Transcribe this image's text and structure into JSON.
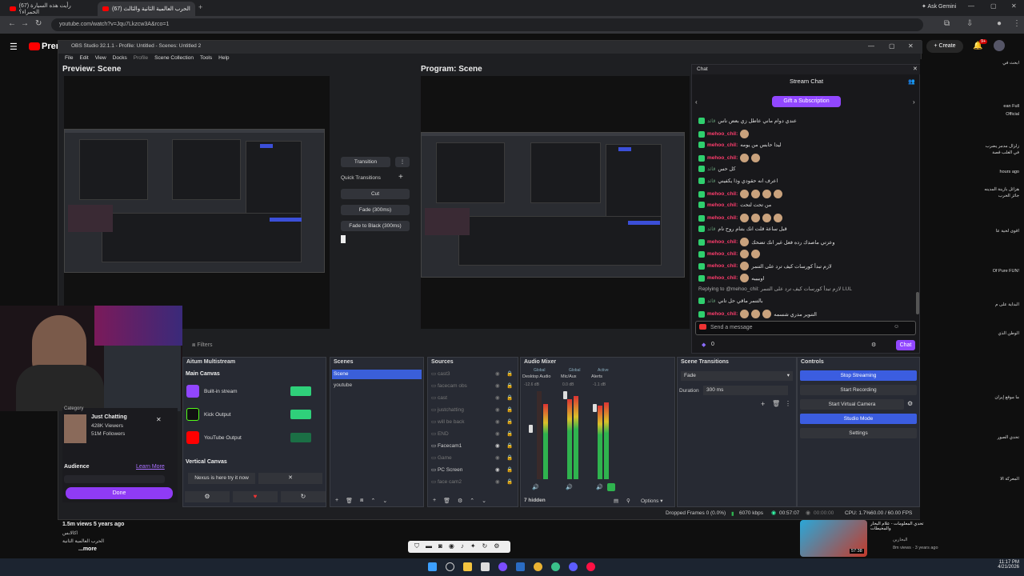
{
  "browser": {
    "tabs": [
      {
        "label": "(67) رأيت هذه السيارة الحمراء؟"
      },
      {
        "label": "(67) الحرب العالمية الثانية والثالث"
      }
    ],
    "url": "youtube.com/watch?v=Jqu7Lkzcw3A&rco=1",
    "ask_gemini": "Ask Gemini"
  },
  "youtube": {
    "logo": "Premium",
    "create": "Create",
    "notif_count": "9+",
    "video_stats": "1.5m views  5 years ago",
    "desc_lines": [
      "اكالابس",
      "الحرب العالمية الثانية",
      "...more"
    ],
    "side_items": [
      {
        "text": "ابحث في"
      },
      {
        "text": "ean Full"
      },
      {
        "text": "Official"
      },
      {
        "text": "زلزال مدمر يضرب"
      },
      {
        "text": "في الغلب قصة"
      },
      {
        "text": "hours ago"
      },
      {
        "text": "هزائل بازينة المدينه"
      },
      {
        "text": "جائز الحرب"
      },
      {
        "text": "اقوى لحية عا"
      },
      {
        "text": "Of Pure FUN!"
      },
      {
        "text": "البداية على م"
      },
      {
        "text": "الوطن الذي"
      },
      {
        "text": "ما موقع إيران"
      },
      {
        "text": "تحدي الصور"
      },
      {
        "text": "المعركة الا"
      }
    ],
    "rec_title": "تحدي المعلومات - علام البحار والمحيطات",
    "rec_channel": "البحارين",
    "rec_meta": "8m views · 3 years ago",
    "rec_duration": "57:38"
  },
  "obs": {
    "title": "OBS Studio 32.1.1 - Profile: Untitled - Scenes: Untitled 2",
    "menu": [
      "File",
      "Edit",
      "View",
      "Docks",
      "Profile",
      "Scene Collection",
      "Tools",
      "Help"
    ],
    "preview_label": "Preview: Scene",
    "program_label": "Program: Scene",
    "transition_btn": "Transition",
    "quick_transitions": "Quick Transitions",
    "qt_items": [
      "Cut",
      "Fade (300ms)",
      "Fade to Black (300ms)"
    ],
    "filters_label": "Filters",
    "docks": {
      "multistream": {
        "title": "Aitum Multistream",
        "main_canvas": "Main Canvas",
        "outputs": [
          {
            "label": "Built-in stream",
            "color": "#9146ff"
          },
          {
            "label": "Kick Output",
            "color": "#53fc18"
          },
          {
            "label": "YouTube Output",
            "color": "#ff0000"
          }
        ],
        "vertical_canvas": "Vertical Canvas",
        "vertical_item": "Nexus is here try it now"
      },
      "scenes": {
        "title": "Scenes",
        "items": [
          "Scene",
          "youtube"
        ]
      },
      "sources": {
        "title": "Sources",
        "items": [
          {
            "label": "cast3",
            "dim": true
          },
          {
            "label": "facecam obs",
            "dim": true
          },
          {
            "label": "cast",
            "dim": true
          },
          {
            "label": "justchatting",
            "dim": true
          },
          {
            "label": "will be back",
            "dim": true
          },
          {
            "label": "END",
            "dim": true
          },
          {
            "label": "Facecam1",
            "dim": false
          },
          {
            "label": "Game",
            "dim": true
          },
          {
            "label": "PC Screen",
            "dim": false
          },
          {
            "label": "face cam2",
            "dim": true
          }
        ]
      },
      "mixer": {
        "title": "Audio Mixer",
        "channels": [
          {
            "label": "Desktop Audio",
            "db": "-12.6 dB"
          },
          {
            "label": "Mic/Aux",
            "db": "0.0 dB"
          },
          {
            "label": "Alerts",
            "db": "-1.1 dB"
          }
        ],
        "tags": [
          "Global",
          "Global",
          "Active"
        ],
        "hidden": "7 hidden",
        "options": "Options"
      },
      "transitions": {
        "title": "Scene Transitions",
        "type": "Fade",
        "duration_label": "Duration",
        "duration_value": "300 ms"
      },
      "controls": {
        "title": "Controls",
        "buttons": [
          "Stop Streaming",
          "Start Recording",
          "Start Virtual Camera",
          "Studio Mode",
          "Settings"
        ]
      }
    },
    "status": {
      "dropped": "Dropped Frames 0 (0.0%)",
      "kbps": "6070 kbps",
      "live_time": "00:57:07",
      "rec_time": "00:00:00",
      "cpu": "CPU: 1.7%",
      "fps": "60.00 / 60.00 FPS"
    }
  },
  "chat": {
    "header": "Chat",
    "title": "Stream Chat",
    "gift": "Gift a Subscription",
    "messages": [
      {
        "user": "قائد",
        "text": "عندي دوام ماني عاطل زي بعض ناس",
        "user2": true,
        "emotes": 0
      },
      {
        "user": "mehoo_chil:",
        "text": "",
        "user2": false,
        "emotes": 1
      },
      {
        "user": "mehoo_chil:",
        "text": "ليدا حابس من يومه",
        "user2": false,
        "emotes": 0
      },
      {
        "user": "mehoo_chil:",
        "text": "",
        "user2": false,
        "emotes": 2
      },
      {
        "user": "قائد",
        "text": "كل حس",
        "user2": true,
        "emotes": 0
      },
      {
        "user": "قائد",
        "text": "اعرف انه حقودي وذا يكفيني",
        "user2": true,
        "emotes": 0
      },
      {
        "user": "mehoo_chil:",
        "text": "",
        "user2": false,
        "emotes": 4
      },
      {
        "user": "mehoo_chil:",
        "text": "من تحت لتحت",
        "user2": false,
        "emotes": 0
      },
      {
        "user": "mehoo_chil:",
        "text": "",
        "user2": false,
        "emotes": 4
      },
      {
        "user": "قائد",
        "text": "قبل ساعة قلت انك بتنام روح نام",
        "user2": true,
        "emotes": 0
      },
      {
        "user": "mehoo_chil:",
        "text": "وعزتي ماصدك رده فعل غير انك تضحك",
        "user2": false,
        "emotes": 1
      },
      {
        "user": "mehoo_chil:",
        "text": "",
        "user2": false,
        "emotes": 2
      },
      {
        "user": "mehoo_chil:",
        "text": "لازم تبدأ كورسات كيف ترد على التنمر",
        "user2": false,
        "emotes": 1
      },
      {
        "user": "mehoo_chil:",
        "text": "اوبيييه",
        "user2": false,
        "emotes": 1
      },
      {
        "user": "",
        "text": "Replying to @mehoo_chil: لازم تبدأ كورسات كيف ترد على التنمر LUL",
        "user2": false,
        "emotes": 0
      },
      {
        "user": "قائد",
        "text": "بالتنمر ماقي حل تاني",
        "user2": true,
        "emotes": 0
      },
      {
        "user": "mehoo_chil:",
        "text": "التنوير مدري شسمه",
        "user2": false,
        "emotes": 3
      }
    ],
    "input_placeholder": "Send a message",
    "points": "0",
    "send": "Chat"
  },
  "overlay": {
    "category": "Category",
    "game": "Just Chatting",
    "viewers": "428K Viewers",
    "followers": "51M Followers",
    "audience": "Audience",
    "learn_more": "Learn More",
    "done": "Done"
  },
  "taskbar": {
    "time": "11:17 PM",
    "date": "4/21/2026"
  }
}
